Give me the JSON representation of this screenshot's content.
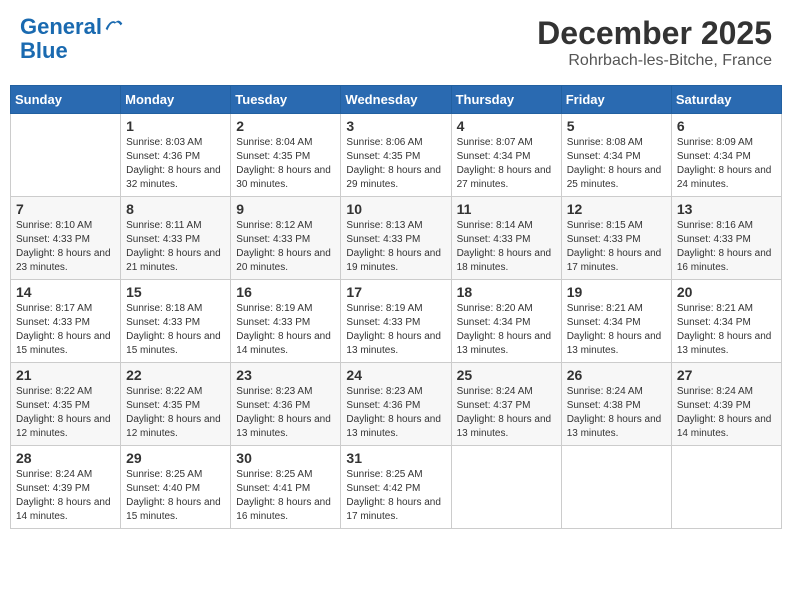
{
  "header": {
    "logo_line1": "General",
    "logo_line2": "Blue",
    "month_year": "December 2025",
    "location": "Rohrbach-les-Bitche, France"
  },
  "days_of_week": [
    "Sunday",
    "Monday",
    "Tuesday",
    "Wednesday",
    "Thursday",
    "Friday",
    "Saturday"
  ],
  "weeks": [
    [
      {
        "day": "",
        "sunrise": "",
        "sunset": "",
        "daylight": ""
      },
      {
        "day": "1",
        "sunrise": "8:03 AM",
        "sunset": "4:36 PM",
        "daylight": "8 hours and 32 minutes."
      },
      {
        "day": "2",
        "sunrise": "8:04 AM",
        "sunset": "4:35 PM",
        "daylight": "8 hours and 30 minutes."
      },
      {
        "day": "3",
        "sunrise": "8:06 AM",
        "sunset": "4:35 PM",
        "daylight": "8 hours and 29 minutes."
      },
      {
        "day": "4",
        "sunrise": "8:07 AM",
        "sunset": "4:34 PM",
        "daylight": "8 hours and 27 minutes."
      },
      {
        "day": "5",
        "sunrise": "8:08 AM",
        "sunset": "4:34 PM",
        "daylight": "8 hours and 25 minutes."
      },
      {
        "day": "6",
        "sunrise": "8:09 AM",
        "sunset": "4:34 PM",
        "daylight": "8 hours and 24 minutes."
      }
    ],
    [
      {
        "day": "7",
        "sunrise": "8:10 AM",
        "sunset": "4:33 PM",
        "daylight": "8 hours and 23 minutes."
      },
      {
        "day": "8",
        "sunrise": "8:11 AM",
        "sunset": "4:33 PM",
        "daylight": "8 hours and 21 minutes."
      },
      {
        "day": "9",
        "sunrise": "8:12 AM",
        "sunset": "4:33 PM",
        "daylight": "8 hours and 20 minutes."
      },
      {
        "day": "10",
        "sunrise": "8:13 AM",
        "sunset": "4:33 PM",
        "daylight": "8 hours and 19 minutes."
      },
      {
        "day": "11",
        "sunrise": "8:14 AM",
        "sunset": "4:33 PM",
        "daylight": "8 hours and 18 minutes."
      },
      {
        "day": "12",
        "sunrise": "8:15 AM",
        "sunset": "4:33 PM",
        "daylight": "8 hours and 17 minutes."
      },
      {
        "day": "13",
        "sunrise": "8:16 AM",
        "sunset": "4:33 PM",
        "daylight": "8 hours and 16 minutes."
      }
    ],
    [
      {
        "day": "14",
        "sunrise": "8:17 AM",
        "sunset": "4:33 PM",
        "daylight": "8 hours and 15 minutes."
      },
      {
        "day": "15",
        "sunrise": "8:18 AM",
        "sunset": "4:33 PM",
        "daylight": "8 hours and 15 minutes."
      },
      {
        "day": "16",
        "sunrise": "8:19 AM",
        "sunset": "4:33 PM",
        "daylight": "8 hours and 14 minutes."
      },
      {
        "day": "17",
        "sunrise": "8:19 AM",
        "sunset": "4:33 PM",
        "daylight": "8 hours and 13 minutes."
      },
      {
        "day": "18",
        "sunrise": "8:20 AM",
        "sunset": "4:34 PM",
        "daylight": "8 hours and 13 minutes."
      },
      {
        "day": "19",
        "sunrise": "8:21 AM",
        "sunset": "4:34 PM",
        "daylight": "8 hours and 13 minutes."
      },
      {
        "day": "20",
        "sunrise": "8:21 AM",
        "sunset": "4:34 PM",
        "daylight": "8 hours and 13 minutes."
      }
    ],
    [
      {
        "day": "21",
        "sunrise": "8:22 AM",
        "sunset": "4:35 PM",
        "daylight": "8 hours and 12 minutes."
      },
      {
        "day": "22",
        "sunrise": "8:22 AM",
        "sunset": "4:35 PM",
        "daylight": "8 hours and 12 minutes."
      },
      {
        "day": "23",
        "sunrise": "8:23 AM",
        "sunset": "4:36 PM",
        "daylight": "8 hours and 13 minutes."
      },
      {
        "day": "24",
        "sunrise": "8:23 AM",
        "sunset": "4:36 PM",
        "daylight": "8 hours and 13 minutes."
      },
      {
        "day": "25",
        "sunrise": "8:24 AM",
        "sunset": "4:37 PM",
        "daylight": "8 hours and 13 minutes."
      },
      {
        "day": "26",
        "sunrise": "8:24 AM",
        "sunset": "4:38 PM",
        "daylight": "8 hours and 13 minutes."
      },
      {
        "day": "27",
        "sunrise": "8:24 AM",
        "sunset": "4:39 PM",
        "daylight": "8 hours and 14 minutes."
      }
    ],
    [
      {
        "day": "28",
        "sunrise": "8:24 AM",
        "sunset": "4:39 PM",
        "daylight": "8 hours and 14 minutes."
      },
      {
        "day": "29",
        "sunrise": "8:25 AM",
        "sunset": "4:40 PM",
        "daylight": "8 hours and 15 minutes."
      },
      {
        "day": "30",
        "sunrise": "8:25 AM",
        "sunset": "4:41 PM",
        "daylight": "8 hours and 16 minutes."
      },
      {
        "day": "31",
        "sunrise": "8:25 AM",
        "sunset": "4:42 PM",
        "daylight": "8 hours and 17 minutes."
      },
      {
        "day": "",
        "sunrise": "",
        "sunset": "",
        "daylight": ""
      },
      {
        "day": "",
        "sunrise": "",
        "sunset": "",
        "daylight": ""
      },
      {
        "day": "",
        "sunrise": "",
        "sunset": "",
        "daylight": ""
      }
    ]
  ],
  "labels": {
    "sunrise": "Sunrise:",
    "sunset": "Sunset:",
    "daylight": "Daylight hours"
  }
}
